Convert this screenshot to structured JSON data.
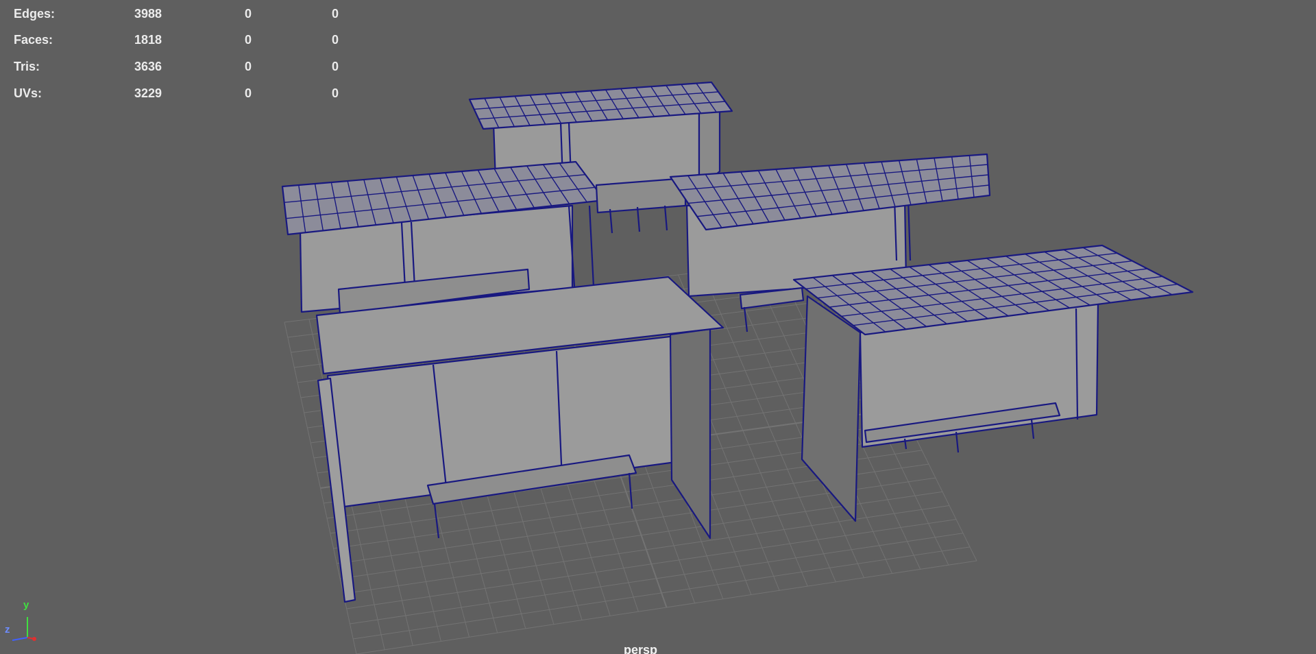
{
  "viewport": {
    "camera_label": "persp",
    "background_color": "#5f5f5f",
    "wireframe_color": "#181880",
    "surface_color": "#999999",
    "grid_color": "#737373"
  },
  "heads_up_display": {
    "rows": [
      {
        "label": "Edges:",
        "values": [
          "3988",
          "0",
          "0"
        ]
      },
      {
        "label": "Faces:",
        "values": [
          "1818",
          "0",
          "0"
        ]
      },
      {
        "label": "Tris:",
        "values": [
          "3636",
          "0",
          "0"
        ]
      },
      {
        "label": "UVs:",
        "values": [
          "3229",
          "0",
          "0"
        ]
      }
    ]
  },
  "axis_indicator": {
    "y_label": "y",
    "z_label": "z",
    "x_color": "#e03030",
    "y_color": "#40e040",
    "z_color": "#4060ff"
  }
}
